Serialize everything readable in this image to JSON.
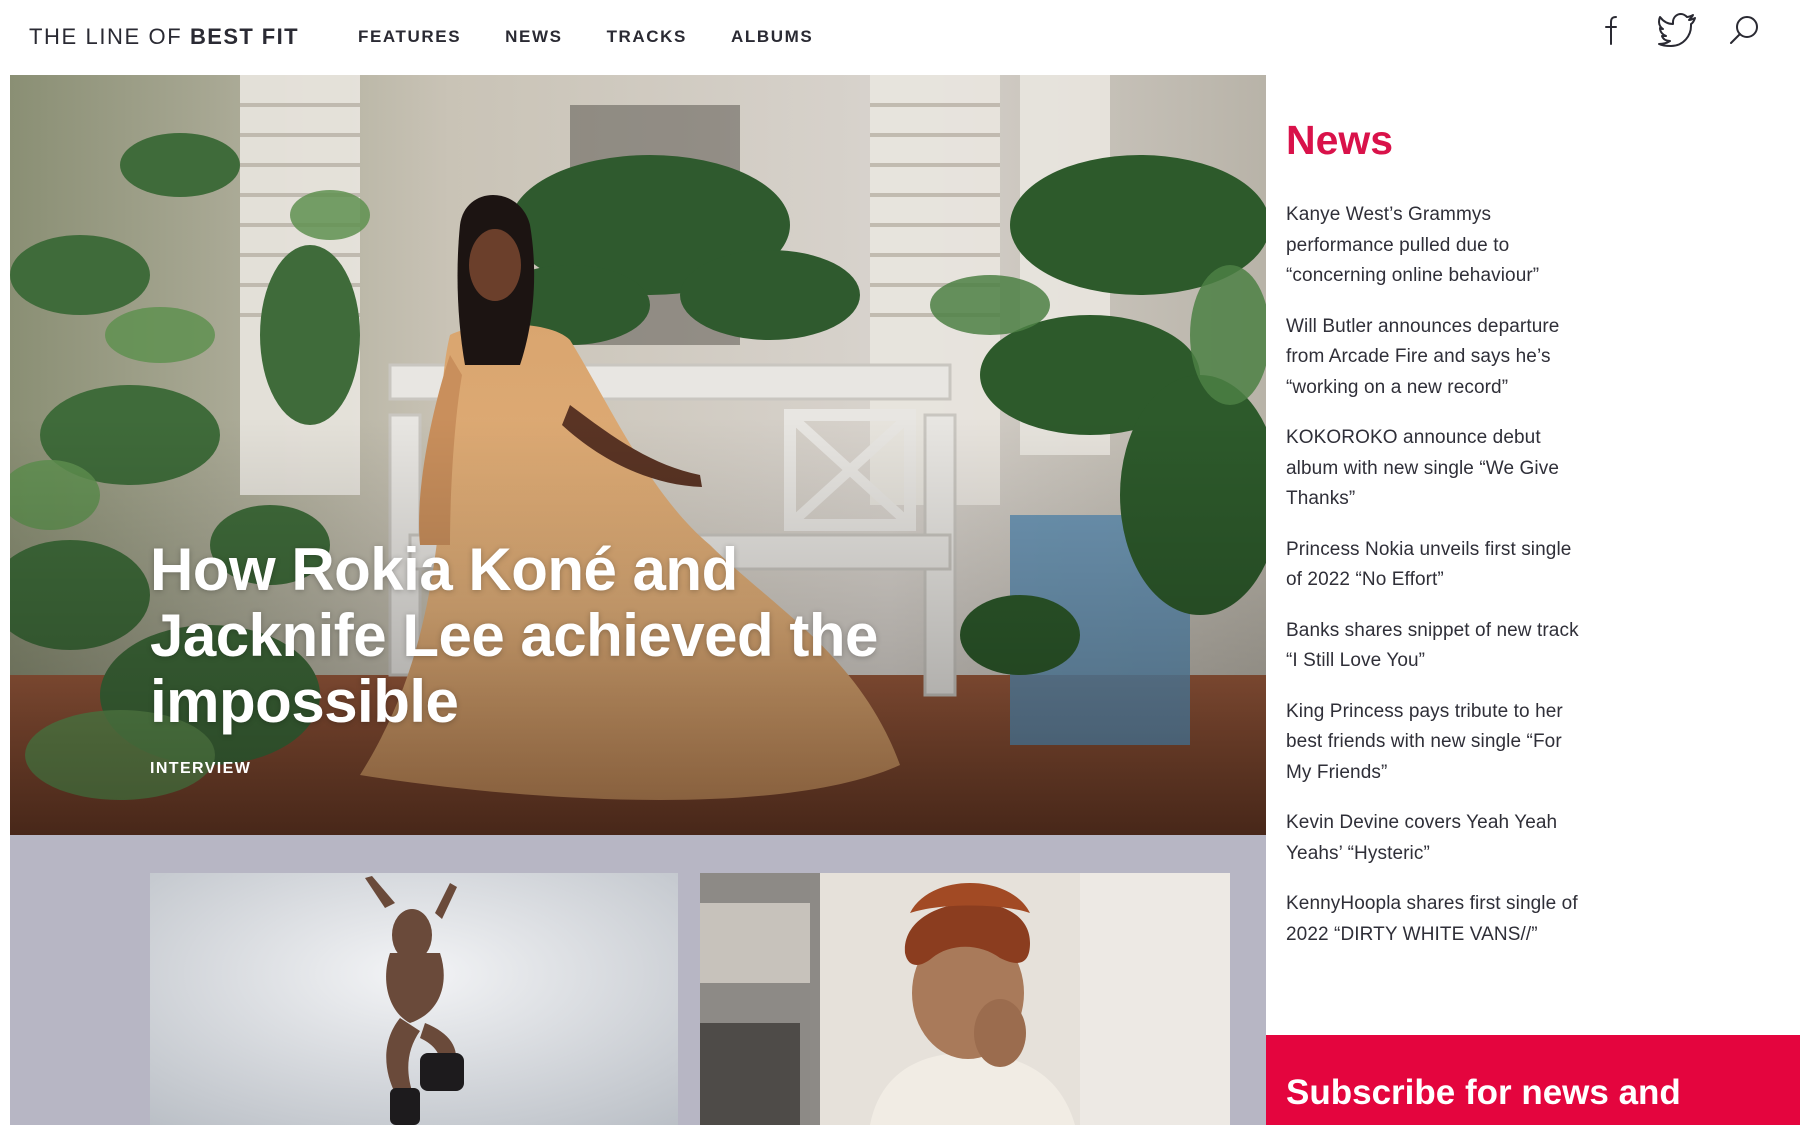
{
  "header": {
    "logo_light": "THE LINE OF ",
    "logo_bold": "BEST FIT",
    "nav": [
      "FEATURES",
      "NEWS",
      "TRACKS",
      "ALBUMS"
    ],
    "social_icons": [
      "facebook-icon",
      "twitter-icon",
      "search-icon"
    ]
  },
  "hero": {
    "title": "How Rokia Koné and Jacknife Lee achieved the impossible",
    "tag": "INTERVIEW"
  },
  "sidebar": {
    "heading": "News",
    "items": [
      "Kanye West’s Grammys performance pulled due to “concerning online behaviour”",
      "Will Butler announces departure from Arcade Fire and says he’s “working on a new record”",
      "KOKOROKO announce debut album with new single “We Give Thanks”",
      "Princess Nokia unveils first single of 2022 “No Effort”",
      "Banks shares snippet of new track “I Still Love You”",
      "King Princess pays tribute to her best friends with new single “For My Friends”",
      "Kevin Devine covers Yeah Yeah Yeahs’ “Hysteric”",
      "KennyHoopla shares first single of 2022 “DIRTY WHITE VANS//”"
    ],
    "subscribe_title": "Subscribe for news and competitions"
  },
  "colors": {
    "accent": "#d9124a",
    "subscribe_bg": "#e4053e",
    "lower_bg": "#b7b6c4"
  }
}
